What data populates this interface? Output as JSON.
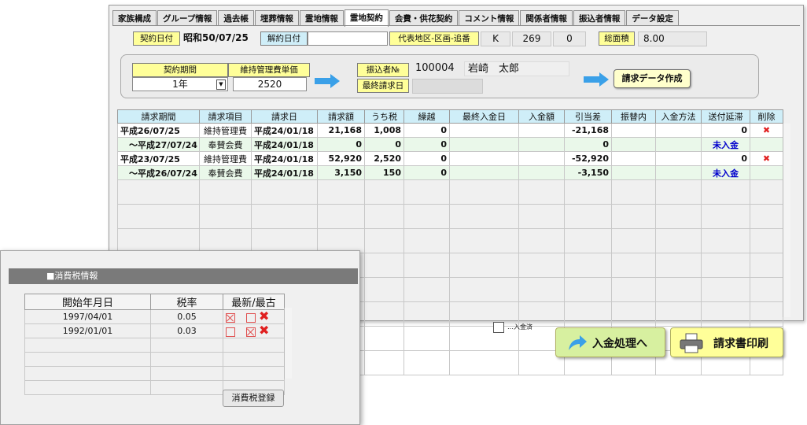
{
  "tabs": [
    "家族構成",
    "グループ情報",
    "過去帳",
    "埋葬情報",
    "霊地情報",
    "霊地契約",
    "会費・供花契約",
    "コメント情報",
    "関係者情報",
    "振込者情報",
    "データ設定"
  ],
  "header": {
    "contract_date_label": "契約日付",
    "contract_date": "昭和50/07/25",
    "cancel_date_label": "解約日付",
    "cancel_date": "",
    "plot_label": "代表地区-区画-追番",
    "plot_area": "K",
    "plot_section": "269",
    "plot_sub": "0",
    "total_area_label": "総面積",
    "total_area": "8.00"
  },
  "panel": {
    "period_label": "契約期間",
    "period_value": "1年",
    "unit_price_label": "維持管理費単価",
    "unit_price": "2520",
    "payer_no_label": "振込者№",
    "payer_no": "100004",
    "payer_name": "岩崎　太郎",
    "last_bill_label": "最終請求日",
    "last_bill": "",
    "create_button": "請求データ作成"
  },
  "grid": {
    "headers": [
      "請求期間",
      "請求項目",
      "請求日",
      "請求額",
      "うち税",
      "繰越",
      "最終入金日",
      "入金額",
      "引当差",
      "振替内",
      "入金方法",
      "送付延滞",
      "削除"
    ],
    "rows": [
      {
        "period": "平成26/07/25",
        "item": "維持管理費",
        "date": "平成24/01/18",
        "amount": "21,168",
        "tax": "1,008",
        "carry": "0",
        "last_pay": "",
        "paid": "",
        "diff": "-21,168",
        "transfer": "",
        "method": "",
        "overdue": "0",
        "status": "",
        "del": "✖",
        "style": "wt"
      },
      {
        "period": "　～平成27/07/24",
        "item": "奉賛会費",
        "date": "平成24/01/18",
        "amount": "0",
        "tax": "0",
        "carry": "0",
        "last_pay": "",
        "paid": "",
        "diff": "0",
        "transfer": "",
        "method": "",
        "overdue": "",
        "status": "未入金",
        "del": "",
        "style": "gr"
      },
      {
        "period": "平成23/07/25",
        "item": "維持管理費",
        "date": "平成24/01/18",
        "amount": "52,920",
        "tax": "2,520",
        "carry": "0",
        "last_pay": "",
        "paid": "",
        "diff": "-52,920",
        "transfer": "",
        "method": "",
        "overdue": "0",
        "status": "",
        "del": "✖",
        "style": "wt"
      },
      {
        "period": "　～平成26/07/24",
        "item": "奉賛会費",
        "date": "平成24/01/18",
        "amount": "3,150",
        "tax": "150",
        "carry": "0",
        "last_pay": "",
        "paid": "",
        "diff": "-3,150",
        "transfer": "",
        "method": "",
        "overdue": "",
        "status": "未入金",
        "del": "",
        "style": "gr"
      }
    ]
  },
  "legend": "…入金済",
  "buttons": {
    "payment": "入金処理へ",
    "print": "請求書印刷"
  },
  "tax_popup": {
    "title": "■消費税情報",
    "headers": [
      "開始年月日",
      "税率",
      "最新/最古"
    ],
    "rows": [
      {
        "date": "1997/04/01",
        "rate": "0.05",
        "latest": true,
        "oldest": false
      },
      {
        "date": "1992/01/01",
        "rate": "0.03",
        "latest": false,
        "oldest": true
      }
    ],
    "register_button": "消費税登録"
  },
  "colors": {
    "label_yellow": "#ffff99",
    "label_blue": "#cfeef8",
    "row_green": "#eaf8ea",
    "unpaid_blue": "#0000cc",
    "delete_red": "#e02020"
  }
}
